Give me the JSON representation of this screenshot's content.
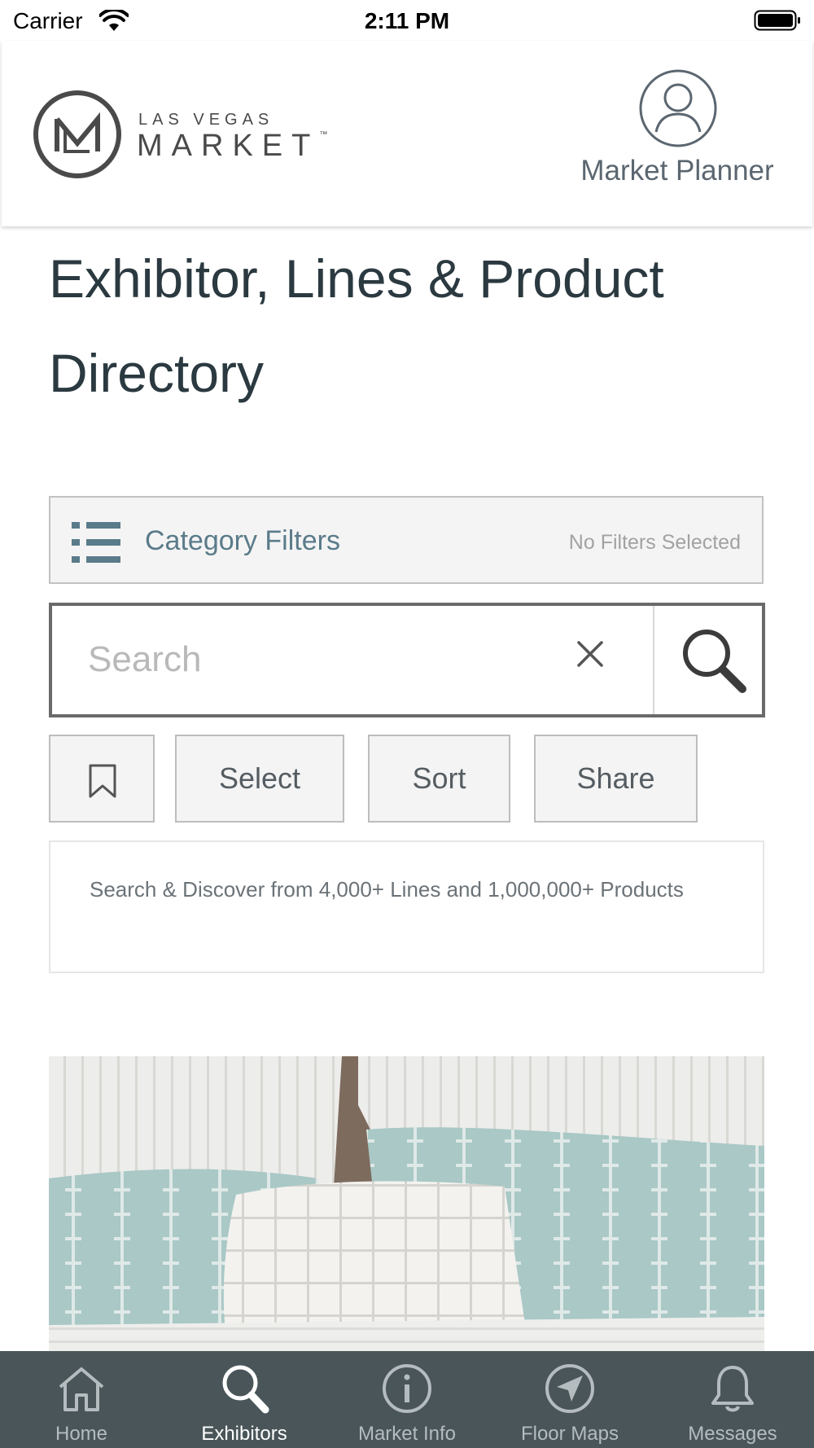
{
  "status_bar": {
    "carrier": "Carrier",
    "time": "2:11 PM"
  },
  "header": {
    "logo_small": "LAS VEGAS",
    "logo_big": "MARKET",
    "logo_tm": "™",
    "planner_label": "Market Planner"
  },
  "page_title": "Exhibitor, Lines & Product Directory",
  "filters": {
    "title": "Category Filters",
    "status": "No Filters Selected"
  },
  "search": {
    "placeholder": "Search",
    "value": ""
  },
  "actions": {
    "select": "Select",
    "sort": "Sort",
    "share": "Share"
  },
  "info_text": "Search & Discover from 4,000+ Lines and 1,000,000+ Products",
  "tabs": [
    {
      "label": "Home",
      "icon": "home-icon",
      "active": false
    },
    {
      "label": "Exhibitors",
      "icon": "search-icon",
      "active": true
    },
    {
      "label": "Market Info",
      "icon": "info-icon",
      "active": false
    },
    {
      "label": "Floor Maps",
      "icon": "navigation-icon",
      "active": false
    },
    {
      "label": "Messages",
      "icon": "bell-icon",
      "active": false
    }
  ],
  "colors": {
    "title": "#2b3940",
    "filter_accent": "#5a7b8a",
    "tabbar_bg": "#495559",
    "tab_active": "#ffffff",
    "tab_inactive": "#b4bcbf"
  }
}
